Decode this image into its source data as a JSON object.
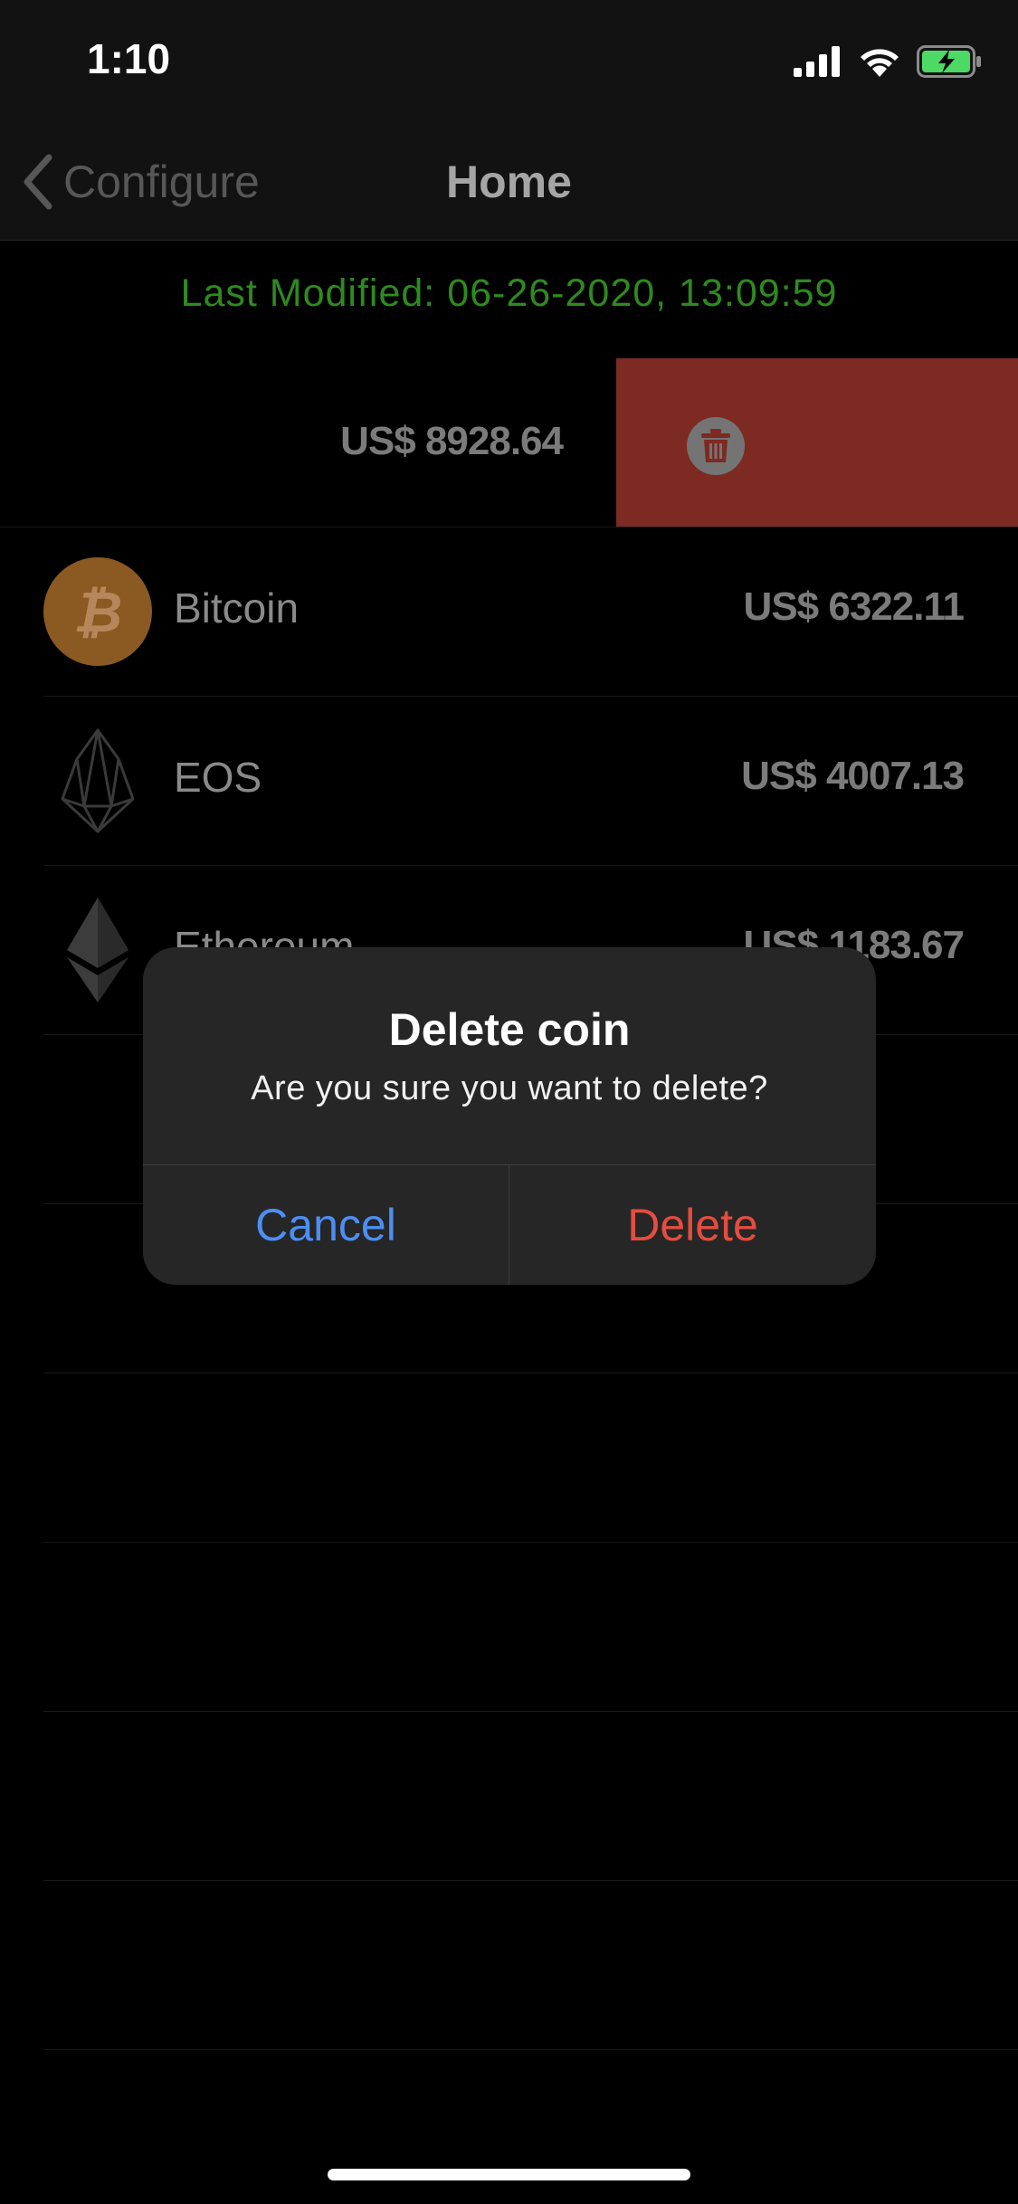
{
  "status_bar": {
    "time": "1:10"
  },
  "nav": {
    "back_label": "Configure",
    "title": "Home"
  },
  "last_modified": "Last Modified: 06-26-2020, 13:09:59",
  "total": {
    "value": "US$ 8928.64"
  },
  "coins": [
    {
      "name": "Bitcoin",
      "value": "US$ 6322.11",
      "icon": "bitcoin-icon"
    },
    {
      "name": "EOS",
      "value": "US$ 4007.13",
      "icon": "eos-icon"
    },
    {
      "name": "Ethereum",
      "value": "US$ 1183.67",
      "icon": "ethereum-icon"
    }
  ],
  "dialog": {
    "title": "Delete coin",
    "message": "Are you sure you want to delete?",
    "cancel_label": "Cancel",
    "delete_label": "Delete"
  },
  "colors": {
    "last_modified_green": "#2f8a1f",
    "swipe_delete_red": "#7c2a22",
    "cancel_blue": "#4d8ef3",
    "delete_red": "#e44d3f",
    "bitcoin_orange": "#8a5a22"
  }
}
